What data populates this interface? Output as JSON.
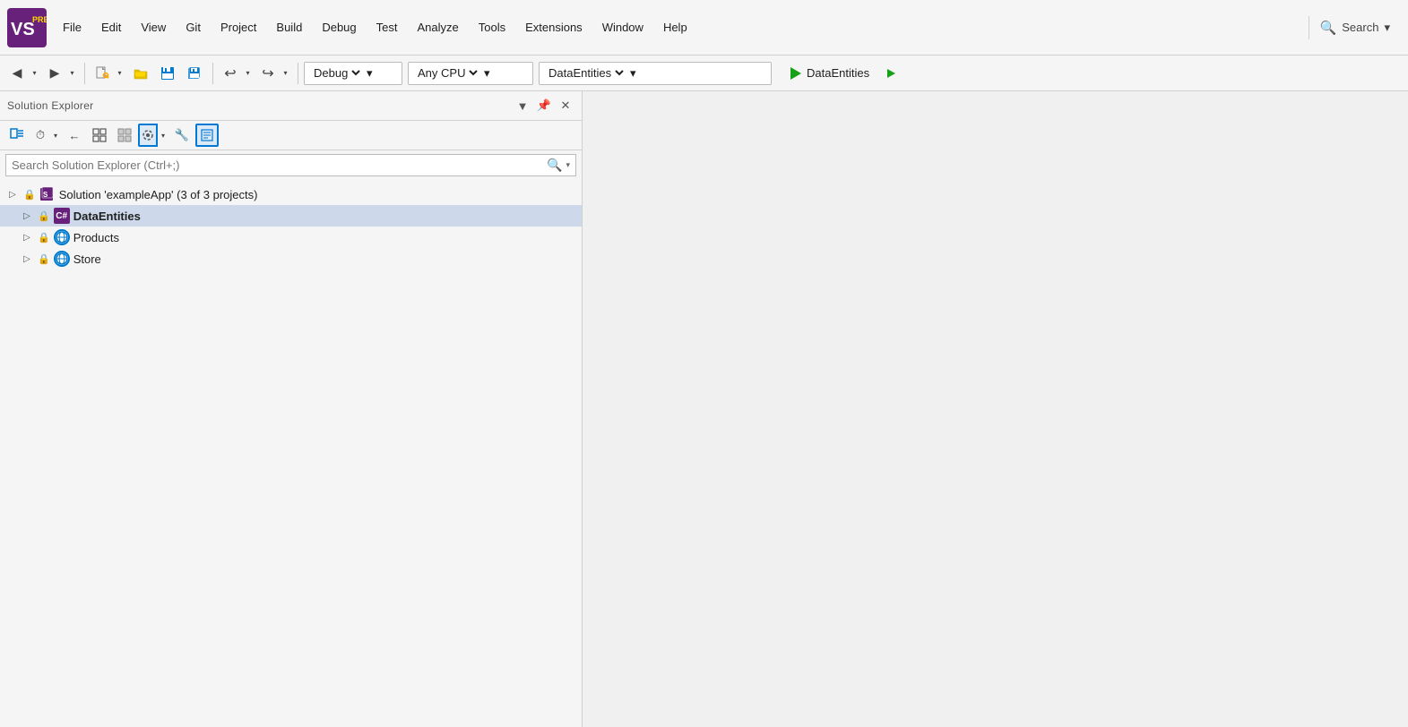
{
  "menu": {
    "items": [
      "File",
      "Edit",
      "View",
      "Git",
      "Project",
      "Build",
      "Debug",
      "Test",
      "Analyze",
      "Tools",
      "Extensions",
      "Window",
      "Help"
    ],
    "search_label": "Search",
    "search_dropdown": "▾"
  },
  "toolbar": {
    "back_label": "◀",
    "forward_label": "▶",
    "new_item_label": "✦",
    "open_label": "📂",
    "save_label": "💾",
    "save_all_label": "💾",
    "undo_label": "↩",
    "redo_label": "↪",
    "config_options": [
      "Debug"
    ],
    "config_selected": "Debug",
    "platform_options": [
      "Any CPU"
    ],
    "platform_selected": "Any CPU",
    "startup_options": [
      "DataEntities"
    ],
    "startup_selected": "DataEntities",
    "run_label": "DataEntities",
    "dropdown_arrow": "▾"
  },
  "solution_explorer": {
    "title": "Solution Explorer",
    "header_icons": [
      "▼",
      "📌",
      "✕"
    ],
    "search_placeholder": "Search Solution Explorer (Ctrl+;)",
    "toolbar_buttons": [
      {
        "id": "sync",
        "icon": "⇄",
        "label": "Sync"
      },
      {
        "id": "history",
        "icon": "⏱",
        "label": "History"
      },
      {
        "id": "history-drop",
        "icon": "▾",
        "label": "History dropdown"
      },
      {
        "id": "back",
        "icon": "←",
        "label": "Back"
      },
      {
        "id": "collapse",
        "icon": "⊟",
        "label": "Collapse All"
      },
      {
        "id": "show-all",
        "icon": "⊞",
        "label": "Show All Files"
      },
      {
        "id": "settings",
        "icon": "⚙",
        "label": "Settings",
        "active": true
      },
      {
        "id": "settings-drop",
        "icon": "▾",
        "label": "Settings dropdown"
      },
      {
        "id": "properties",
        "icon": "🔧",
        "label": "Properties"
      },
      {
        "id": "view-code",
        "icon": "⊡",
        "label": "View Code",
        "active": true
      }
    ],
    "solution_node": {
      "label": "Solution 'exampleApp' (3 of 3 projects)",
      "icon": "solution"
    },
    "projects": [
      {
        "name": "DataEntities",
        "icon": "csharp",
        "selected": true,
        "expanded": false
      },
      {
        "name": "Products",
        "icon": "web",
        "selected": false,
        "expanded": false
      },
      {
        "name": "Store",
        "icon": "web",
        "selected": false,
        "expanded": false
      }
    ]
  },
  "colors": {
    "selected_bg": "#cdd9ea",
    "accent": "#0078d4",
    "play_green": "#16a016",
    "vs_purple": "#68217a"
  }
}
